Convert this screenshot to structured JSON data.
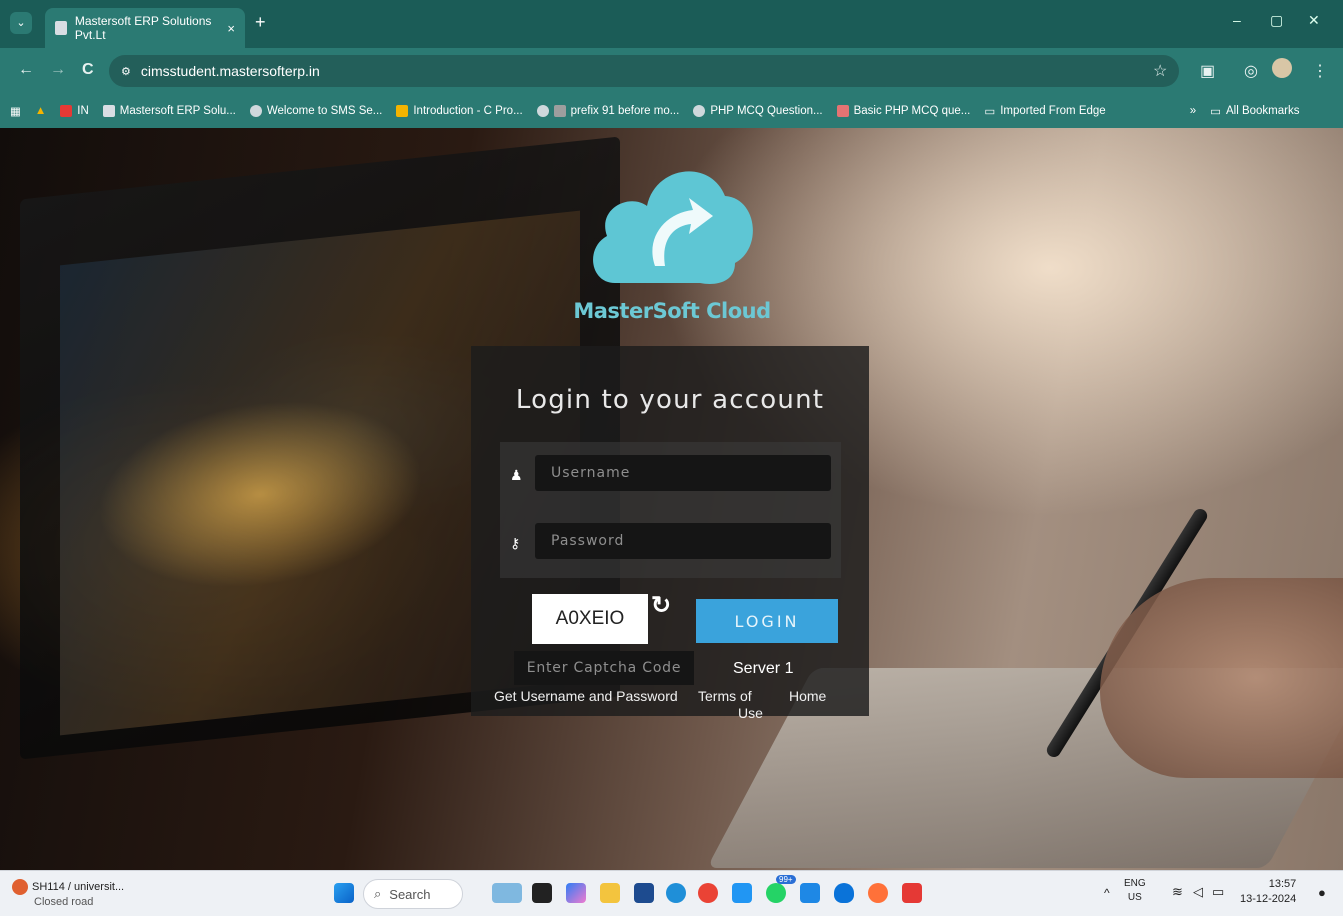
{
  "browser": {
    "tab_title": "Mastersoft ERP Solutions Pvt.Lt",
    "tab_close": "×",
    "new_tab": "+",
    "tabs_menu": "⌄",
    "url": "cimsstudent.mastersofterp.in",
    "controls": {
      "minimize": "–",
      "restore": "▢",
      "close": "✕"
    },
    "nav": {
      "back": "←",
      "forward": "→",
      "reload": "C"
    },
    "bookmarks": [
      {
        "label": "IN",
        "color": "#e53935"
      },
      {
        "label": "Mastersoft ERP Solu...",
        "color": "#d9dde3"
      },
      {
        "label": "Welcome to SMS Se...",
        "color": "#cfd8dc"
      },
      {
        "label": "Introduction - C Pro...",
        "color": "#f4b400"
      },
      {
        "label": "prefix 91 before mo...",
        "color": "#9e9e9e"
      },
      {
        "label": "PHP MCQ Question...",
        "color": "#cfd8dc"
      },
      {
        "label": "Basic PHP MCQ que...",
        "color": "#e57373"
      },
      {
        "label": "Imported From Edge",
        "color": "#2b7a73"
      }
    ],
    "bookmarks_overflow": "»",
    "all_bookmarks": "All Bookmarks"
  },
  "login": {
    "brand": "MasterSoft Cloud",
    "title": "Login to your account",
    "username_placeholder": "Username",
    "password_placeholder": "Password",
    "captcha_text": "A0XEIO",
    "login_label": "LOGIN",
    "captcha_placeholder": "Enter Captcha Code",
    "server": "Server 1",
    "links": {
      "get_credentials": "Get Username and Password",
      "terms_line1": "Terms of",
      "terms_line2": "Use",
      "home": "Home"
    }
  },
  "taskbar": {
    "weather_title": "SH114 / universit...",
    "weather_sub": "Closed road",
    "search": "Search",
    "lang_line1": "ENG",
    "lang_line2": "US",
    "time": "13:57",
    "date": "13-12-2024",
    "badge": "99+"
  },
  "colors": {
    "accent": "#3aa3dc",
    "brand": "#6cc8d4",
    "browser": "#2b7a73"
  }
}
